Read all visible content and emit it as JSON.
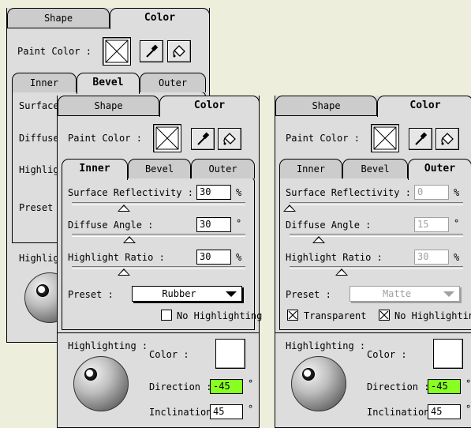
{
  "colors": {
    "desktop": "#eeeedd",
    "panel": "#dddddd",
    "tab_inactive": "#cccccc",
    "disabled_text": "#a0a0a0",
    "direction_highlight": "#88ff22"
  },
  "icons": {
    "eyedropper": "eyedropper-icon",
    "paint_bucket": "paint-bucket-icon",
    "none_swatch": "no-fill-icon",
    "checkbox_x": "check-x-icon",
    "light_sphere": "sphere-preview",
    "dropdown": "chevron-down-icon"
  },
  "back": {
    "tabs": [
      "Shape",
      "Color"
    ],
    "active_tab": "Color",
    "paint_color_label": "Paint Color :",
    "subtabs": [
      "Inner",
      "Bevel",
      "Outer"
    ],
    "active_subtab": "Bevel",
    "rows": [
      "Surface",
      "Diffuse",
      "Highlight",
      "Preset"
    ],
    "highlighting_label": "Highlight"
  },
  "middle": {
    "tabs": [
      "Shape",
      "Color"
    ],
    "active_tab": "Color",
    "paint_color_label": "Paint Color :",
    "subtabs": [
      "Inner",
      "Bevel",
      "Outer"
    ],
    "active_subtab": "Inner",
    "surface_label": "Surface Reflectivity :",
    "surface_value": "30",
    "surface_unit": "%",
    "surface_slider": 0.3,
    "diffuse_label": "Diffuse Angle :",
    "diffuse_value": "30",
    "diffuse_unit": "°",
    "diffuse_slider": 0.33,
    "highlight_label": "Highlight Ratio :",
    "highlight_value": "30",
    "highlight_unit": "%",
    "highlight_slider": 0.3,
    "preset_label": "Preset :",
    "preset_value": "Rubber",
    "no_highlighting_label": "No Highlighting",
    "no_highlighting_checked": false,
    "highlighting_label": "Highlighting :",
    "color_label": "Color :",
    "direction_label": "Direction :",
    "direction_value": "-45",
    "direction_unit": "°",
    "inclination_label": "Inclination :",
    "inclination_value": "45",
    "inclination_unit": "°"
  },
  "right": {
    "tabs": [
      "Shape",
      "Color"
    ],
    "active_tab": "Color",
    "paint_color_label": "Paint Color :",
    "subtabs": [
      "Inner",
      "Bevel",
      "Outer"
    ],
    "active_subtab": "Outer",
    "surface_label": "Surface Reflectivity :",
    "surface_value": "0",
    "surface_unit": "%",
    "surface_slider": 0.0,
    "diffuse_label": "Diffuse Angle :",
    "diffuse_value": "15",
    "diffuse_unit": "°",
    "diffuse_slider": 0.17,
    "highlight_label": "Highlight Ratio :",
    "highlight_value": "30",
    "highlight_unit": "%",
    "highlight_slider": 0.3,
    "preset_label": "Preset :",
    "preset_value": "Matte",
    "transparent_label": "Transparent",
    "transparent_checked": true,
    "no_highlighting_label": "No Highlighting",
    "no_highlighting_checked": true,
    "highlighting_label": "Highlighting :",
    "color_label": "Color :",
    "direction_label": "Direction :",
    "direction_value": "-45",
    "direction_unit": "°",
    "inclination_label": "Inclination :",
    "inclination_value": "45",
    "inclination_unit": "°"
  }
}
